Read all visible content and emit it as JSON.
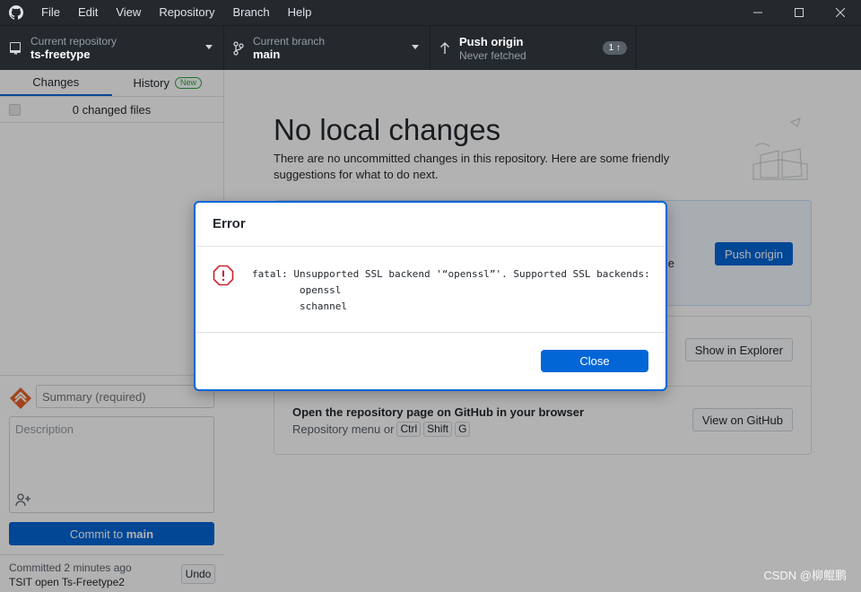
{
  "menu": [
    "File",
    "Edit",
    "View",
    "Repository",
    "Branch",
    "Help"
  ],
  "toolbar": {
    "repo": {
      "title": "Current repository",
      "value": "ts-freetype"
    },
    "branch": {
      "title": "Current branch",
      "value": "main"
    },
    "push": {
      "title": "Push origin",
      "sub": "Never fetched",
      "badge": "1 ↑"
    }
  },
  "sidebar": {
    "tabs": [
      {
        "label": "Changes"
      },
      {
        "label": "History",
        "badge": "New"
      }
    ],
    "changed_files": "0 changed files",
    "summary_placeholder": "Summary (required)",
    "description_placeholder": "Description",
    "commit_prefix": "Commit to ",
    "commit_branch": "main",
    "last_commit": {
      "line1": "Committed 2 minutes ago",
      "line2": "TSIT open Ts-Freetype2",
      "undo": "Undo"
    }
  },
  "main": {
    "title": "No local changes",
    "description": "There are no uncommitted changes in this repository. Here are some friendly suggestions for what to do next.",
    "push_card": {
      "partial_text": "e",
      "button": "Push origin"
    },
    "explorer": {
      "button": "Show in Explorer"
    },
    "github": {
      "title": "Open the repository page on GitHub in your browser",
      "sub": "Repository menu or",
      "keys": [
        "Ctrl",
        "Shift",
        "G"
      ],
      "button": "View on GitHub"
    }
  },
  "dialog": {
    "title": "Error",
    "message": "fatal: Unsupported SSL backend '“openssl”'. Supported SSL backends:\n        openssl\n        schannel",
    "close": "Close"
  },
  "watermark": "CSDN @柳鲲鹏",
  "colors": {
    "accent": "#0366d6",
    "toolbar": "#24292e",
    "error": "#cb2431"
  }
}
